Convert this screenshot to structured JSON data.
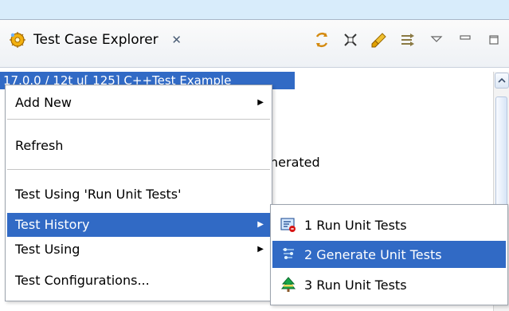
{
  "view": {
    "title": "Test Case Explorer",
    "close_glyph": "✕",
    "toolbar": {
      "icons": [
        "sync-icon",
        "collapse-icon",
        "brush-icon",
        "filter-icon",
        "view-menu-icon",
        "minimize-icon",
        "maximize-icon"
      ]
    }
  },
  "tree": {
    "selected_text": "17.0.0 / 12t u[ 125] C++Test Example",
    "partial_item": "nerated"
  },
  "context_menu": {
    "items": [
      {
        "label": "Add New",
        "has_submenu": true
      },
      {
        "label": "Refresh",
        "has_submenu": false
      },
      {
        "label": "Test Using 'Run Unit Tests'",
        "has_submenu": false
      },
      {
        "label": "Test History",
        "has_submenu": true,
        "highlighted": true
      },
      {
        "label": "Test Using",
        "has_submenu": true
      },
      {
        "label": "Test Configurations...",
        "has_submenu": false
      }
    ]
  },
  "submenu": {
    "items": [
      {
        "label": "1 Run Unit Tests",
        "icon": "run-unit-tests-icon"
      },
      {
        "label": "2 Generate Unit Tests",
        "icon": "generate-tests-icon",
        "highlighted": true
      },
      {
        "label": "3 Run Unit Tests",
        "icon": "tree-tests-icon"
      }
    ]
  },
  "colors": {
    "selection": "#316ac5",
    "background": "#d8ecfb"
  }
}
